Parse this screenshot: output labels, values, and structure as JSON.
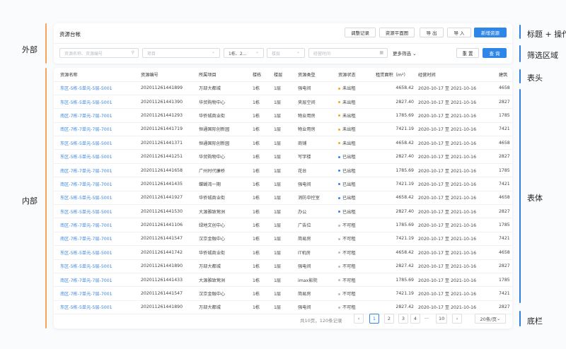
{
  "annotations": {
    "left": {
      "outer": "外部",
      "inner": "内部"
    },
    "right": {
      "title_ops": "标题 + 操作",
      "filter_area": "筛选区域",
      "table_head": "表头",
      "table_body": "表体",
      "footer": "底栏"
    }
  },
  "header": {
    "title": "资源台帐",
    "buttons": {
      "adjust_log": "调整记录",
      "floor_plan": "资源平面图",
      "export": "导 出",
      "import": "导 入",
      "add": "新增资源"
    }
  },
  "filters": {
    "search_placeholder": "资源名称、资源编号",
    "project_placeholder": "项目",
    "building_value": "1栋、2...",
    "floor_placeholder": "楼层",
    "time_placeholder": "经营时间",
    "more_label": "更多筛选",
    "reset_label": "重 置",
    "query_label": "查 询"
  },
  "table": {
    "columns": [
      "资源名称",
      "资源编号",
      "所属项目",
      "楼栋",
      "楼层",
      "资源类型",
      "资源状态",
      "租赁面积（m²）",
      "经营时间",
      "建筑"
    ],
    "status_colors": {
      "未出租": "#f5a623",
      "已出租": "#2e86e8",
      "不可租": "#b7bbc1"
    },
    "rows": [
      [
        "东区-5栋-5单元-5层-5001",
        "202011261441899",
        "万部大都城",
        "1栋",
        "1层",
        "强电间",
        "未出租",
        "4658.42",
        "2020-10-17 至 2021-10-16",
        "4658"
      ],
      [
        "东区-5栋-5单元-5层-5001",
        "202011261441390",
        "华贸购物中心",
        "1栋",
        "1层",
        "夹层空间",
        "未出租",
        "2827.40",
        "2020-10-17 至 2021-10-16",
        "2827"
      ],
      [
        "南区-7栋-7单元-7层-7001",
        "202011261441293",
        "华侨城商业街",
        "1栋",
        "1层",
        "物业用房",
        "未出租",
        "1785.69",
        "2020-10-17 至 2021-10-16",
        "1785"
      ],
      [
        "南区-7栋-7单元-7层-7001",
        "202011261441719",
        "恒通国际创新园",
        "1栋",
        "1层",
        "物业用房",
        "未出租",
        "7421.19",
        "2020-10-17 至 2021-10-16",
        "7421"
      ],
      [
        "东区-5栋-5单元-5层-5001",
        "202011261441371",
        "恒通国际创新园",
        "1栋",
        "1层",
        "商铺",
        "未出租",
        "4658.42",
        "2020-10-17 至 2021-10-16",
        "4658"
      ],
      [
        "东区-5栋-5单元-5层-5001",
        "202011261441251",
        "华贸购物中心",
        "1栋",
        "1层",
        "写字楼",
        "已出租",
        "2827.40",
        "2020-10-17 至 2021-10-16",
        "2827"
      ],
      [
        "南区-7栋-7单元-7层-7001",
        "202011261441658",
        "广州时代廉桥",
        "1栋",
        "1层",
        "花台",
        "已出租",
        "1785.69",
        "2020-10-17 至 2021-10-16",
        "1785"
      ],
      [
        "南区-7栋-7单元-7层-7001",
        "202011261441435",
        "蝶蝴湾一期",
        "1栋",
        "1层",
        "强电间",
        "已出租",
        "7421.19",
        "2020-10-17 至 2021-10-16",
        "7421"
      ],
      [
        "东区-5栋-5单元-5层-5001",
        "202011261441927",
        "华侨城商业街",
        "1栋",
        "1层",
        "消防中控室",
        "已出租",
        "4658.42",
        "2020-10-17 至 2021-10-16",
        "4658"
      ],
      [
        "东区-5栋-5单元-5层-5001",
        "202011261441530",
        "大源雅致莺洲",
        "1栋",
        "1层",
        "办公",
        "已出租",
        "2827.40",
        "2020-10-17 至 2021-10-16",
        "2827"
      ],
      [
        "南区-7栋-7单元-7层-7001",
        "202011261441106",
        "绿地文创中心",
        "1栋",
        "1层",
        "广告位",
        "不可租",
        "1785.69",
        "2020-10-17 至 2021-10-16",
        "1785"
      ],
      [
        "南区-7栋-7单元-7层-7001",
        "202011261441547",
        "汉京金融中心",
        "1栋",
        "1层",
        "简易房",
        "不可租",
        "7421.19",
        "2020-10-17 至 2021-10-16",
        "7421"
      ],
      [
        "东区-5栋-5单元-5层-5001",
        "202011261441742",
        "华侨城商业街",
        "1栋",
        "1层",
        "IT机房",
        "不可租",
        "4658.42",
        "2020-10-17 至 2021-10-16",
        "4658"
      ],
      [
        "东区-5栋-5单元-5层-5001",
        "202011261441890",
        "万部大都城",
        "1栋",
        "1层",
        "强电间",
        "不可租",
        "2827.42",
        "2020-10-17 至 2021-10-16",
        "2827"
      ],
      [
        "南区-7栋-7单元-7层-7001",
        "202011261441433",
        "大源雅致莺洲",
        "1栋",
        "1层",
        "imax影院",
        "不可租",
        "1785.69",
        "2020-10-17 至 2021-10-16",
        "1785"
      ],
      [
        "南区-7栋-7单元-7层-7001",
        "202011261441547",
        "汉京金融中心",
        "1栋",
        "1层",
        "简易房",
        "不可租",
        "7421.19",
        "2020-10-17 至 2021-10-16",
        "7421"
      ],
      [
        "东区-5栋-5单元-5层-5001",
        "202011261441890",
        "万部大都城",
        "1栋",
        "1层",
        "强电间",
        "不可租",
        "2827.42",
        "2020-10-17 至 2021-10-16",
        "2827"
      ]
    ]
  },
  "footer": {
    "summary": "共10页，120条记录",
    "prev_icon": "chevron-left-icon",
    "next_icon": "chevron-right-icon",
    "pages": [
      "1",
      "2",
      "3",
      "4",
      "···",
      "10"
    ],
    "current_page": "1",
    "page_size": "20条/页"
  }
}
